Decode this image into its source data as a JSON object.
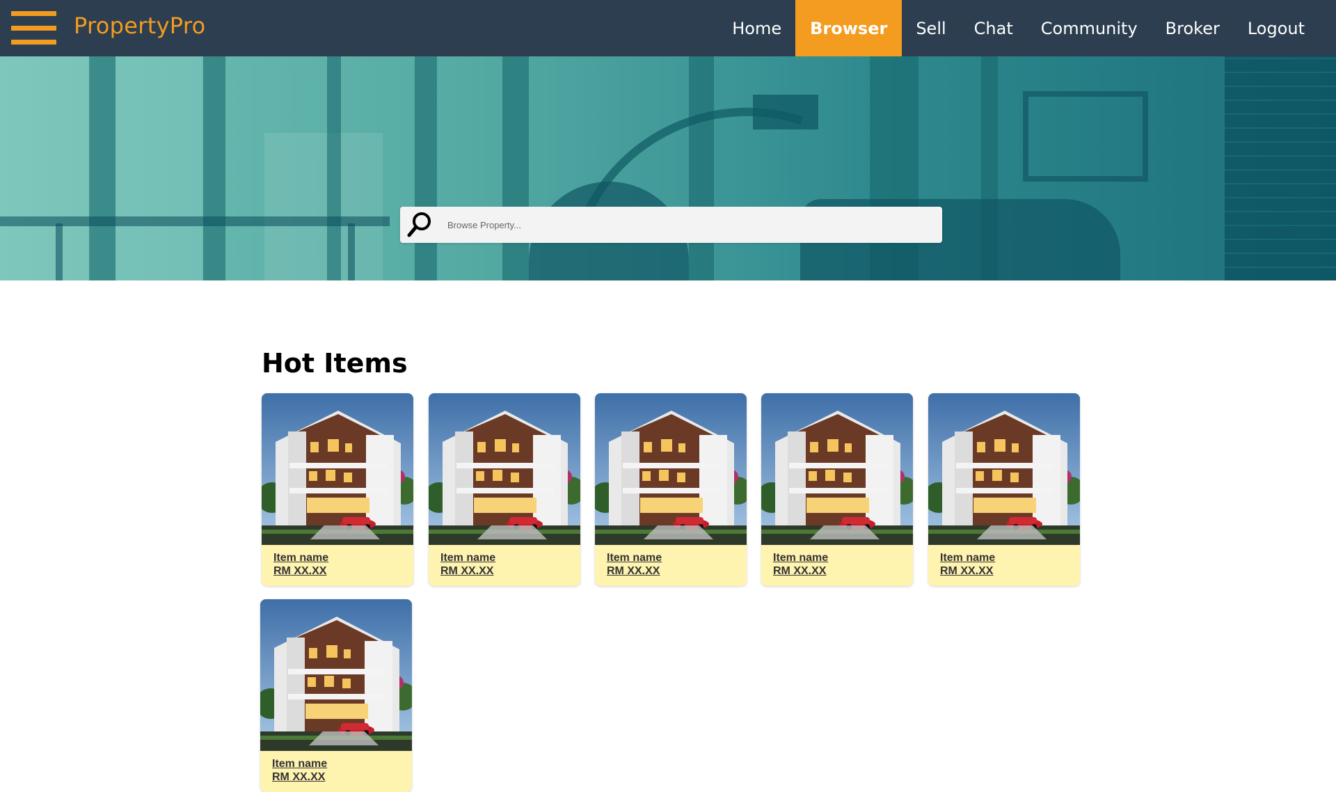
{
  "nav": {
    "brand": "PropertyPro",
    "links": [
      "Home",
      "Browser",
      "Sell",
      "Chat",
      "Community",
      "Broker",
      "Logout"
    ],
    "active": "Browser"
  },
  "search": {
    "placeholder": "Browse Property..."
  },
  "hot_items": {
    "title": "Hot Items",
    "items": [
      {
        "name": "Item name",
        "price": "RM XX.XX"
      },
      {
        "name": "Item name",
        "price": "RM XX.XX"
      },
      {
        "name": "Item name",
        "price": "RM XX.XX"
      },
      {
        "name": "Item name",
        "price": "RM XX.XX"
      },
      {
        "name": "Item name",
        "price": "RM XX.XX"
      },
      {
        "name": "Item name",
        "price": "RM XX.XX"
      }
    ]
  },
  "colors": {
    "navbar": "#2c3e50",
    "accent": "#f39c1f",
    "card_bg": "#fff3b0"
  },
  "icons": [
    "menu-icon",
    "search-icon"
  ]
}
